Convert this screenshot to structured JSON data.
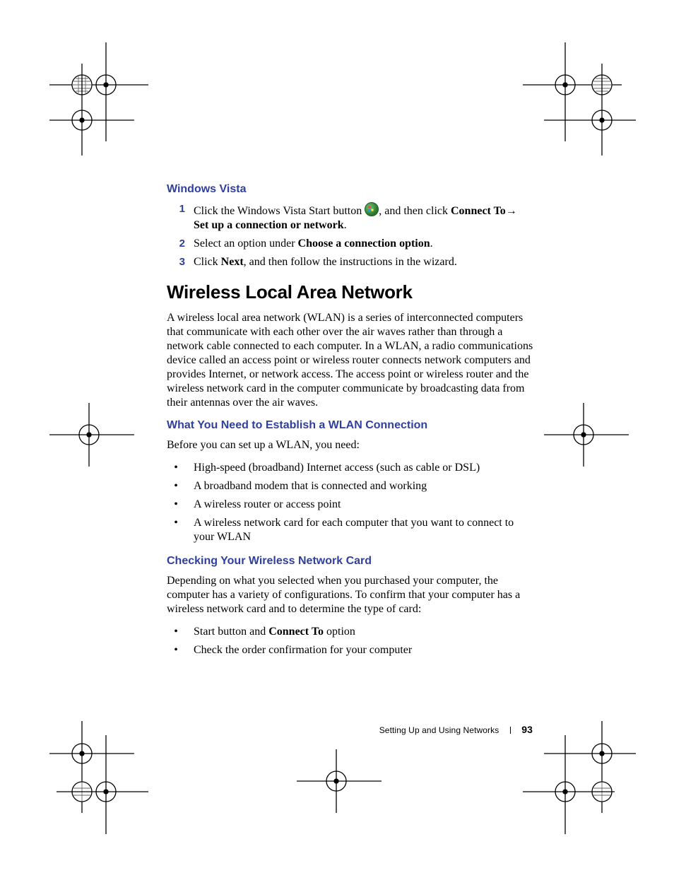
{
  "section1": {
    "heading": "Windows Vista",
    "steps": [
      {
        "num": "1",
        "pre": "Click the Windows Vista Start button ",
        "post_comma": ",  and then click ",
        "bold1": "Connect To",
        "arrow": "→ ",
        "bold2": "Set up a connection or network",
        "tail": "."
      },
      {
        "num": "2",
        "pre": "Select an option under ",
        "bold1": "Choose a connection option",
        "tail": "."
      },
      {
        "num": "3",
        "pre": "Click ",
        "bold1": "Next",
        "tail": ", and then follow the instructions in the wizard."
      }
    ]
  },
  "h1": "Wireless Local Area Network",
  "para1": "A wireless local area network (WLAN) is a series of interconnected computers that communicate with each other over the air waves rather than through a network cable connected to each computer. In a WLAN, a radio communications device called an access point or wireless router connects network computers and provides Internet, or network access. The access point or wireless router and the wireless network card in the computer communicate by broadcasting data from their antennas over the air waves.",
  "section2": {
    "heading": "What You Need to Establish a WLAN Connection",
    "intro": "Before you can set up a WLAN, you need:",
    "bullets": [
      "High-speed (broadband) Internet access (such as cable or DSL)",
      "A broadband modem that is connected and working",
      "A wireless router or access point",
      "A wireless network card for each computer that you want to connect to your WLAN"
    ]
  },
  "section3": {
    "heading": "Checking Your Wireless Network Card",
    "intro": "Depending on what you selected when you purchased your computer, the computer has a variety of configurations. To confirm that your computer has a wireless network card and to determine the type of card:",
    "bullets": [
      {
        "pre": "Start button and ",
        "bold": "Connect To",
        "tail": " option"
      },
      {
        "pre": "Check the order confirmation for your computer",
        "bold": "",
        "tail": ""
      }
    ]
  },
  "footer": {
    "chapter": "Setting Up and Using Networks",
    "page": "93"
  }
}
